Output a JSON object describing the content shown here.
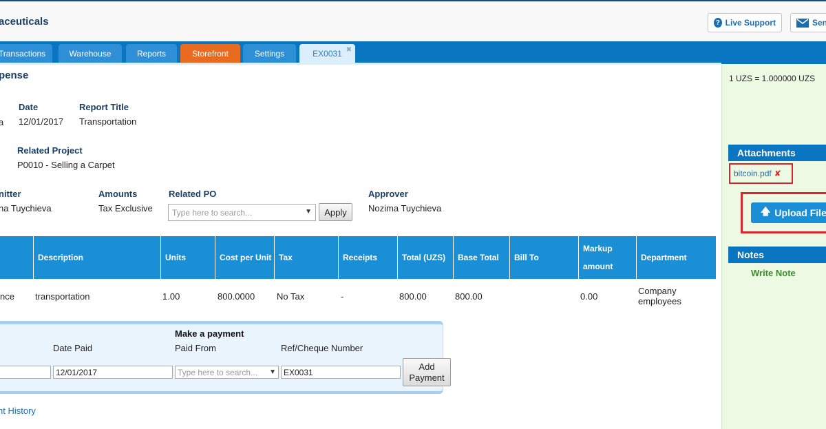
{
  "header": {
    "company": "aceuticals",
    "live_support": "Live Support",
    "send": "Sen"
  },
  "nav": {
    "tabs": [
      "Transactions",
      "Warehouse",
      "Reports",
      "Storefront",
      "Settings",
      "EX0031"
    ],
    "close_glyph": "✖"
  },
  "page": {
    "title": "pense"
  },
  "details": {
    "row1_first_value": "a",
    "date_label": "Date",
    "date_value": "12/01/2017",
    "report_title_label": "Report Title",
    "report_title_value": "Transportation",
    "related_project_label": "Related Project",
    "related_project_value": "P0010 - Selling a Carpet",
    "submitter_label": "nitter",
    "submitter_value": "na Tuychieva",
    "amounts_label": "Amounts",
    "amounts_value": "Tax Exclusive",
    "related_po_label": "Related PO",
    "related_po_placeholder": "Type here to search...",
    "apply_label": "Apply",
    "approver_label": "Approver",
    "approver_value": "Nozima Tuychieva"
  },
  "table": {
    "columns": [
      "Description",
      "Units",
      "Cost per Unit",
      "Tax",
      "Receipts",
      "Total (UZS)",
      "Base Total",
      "Bill To",
      "Markup amount",
      "Department"
    ],
    "row": [
      "nce",
      "transportation",
      "1.00",
      "800.0000",
      "No Tax",
      "-",
      "800.00",
      "800.00",
      "",
      "0.00",
      "Company employees"
    ]
  },
  "payment": {
    "title": "Make a payment",
    "date_paid_label": "Date Paid",
    "paid_from_label": "Paid From",
    "ref_label": "Ref/Cheque Number",
    "amount_value": "",
    "date_value": "12/01/2017",
    "paid_from_placeholder": "Type here to search...",
    "ref_value": "EX0031",
    "add_button": "Add Payment"
  },
  "history_link": "nt History",
  "sidebar": {
    "rate": "1 UZS = 1.000000 UZS",
    "attachments_title": "Attachments",
    "attachment_file": "bitcoin.pdf",
    "upload_label": "Upload File",
    "notes_title": "Notes",
    "write_note": "Write Note"
  },
  "colors": {
    "nav_blue": "#0a75c0",
    "storefront_orange": "#e96b1f",
    "highlight_red": "#d9262c",
    "sidebar_green": "#eef9e4"
  }
}
